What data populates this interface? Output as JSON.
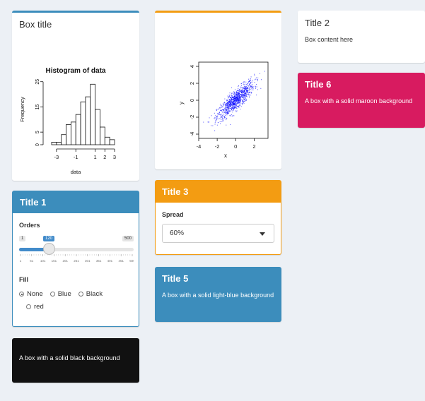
{
  "box_hist": {
    "title": "Box title",
    "chart_data": {
      "type": "bar",
      "title": "Histogram of data",
      "xlabel": "data",
      "ylabel": "Frequency",
      "x_ticks": [
        "-3",
        "-1",
        "1",
        "2",
        "3"
      ],
      "y_ticks": [
        "0",
        "5",
        "15",
        "25"
      ],
      "bins": [
        -3.5,
        -3,
        -2.5,
        -2,
        -1.5,
        -1,
        -0.5,
        0,
        0.5,
        1,
        1.5,
        2,
        2.5,
        3
      ],
      "values": [
        1,
        1,
        4,
        8,
        9,
        12,
        17,
        19,
        24,
        14,
        7,
        3,
        2
      ],
      "ylim": [
        0,
        28
      ]
    }
  },
  "box_scatter": {
    "chart_data": {
      "type": "scatter",
      "xlabel": "x",
      "ylabel": "y",
      "x_ticks": [
        "-4",
        "-2",
        "0",
        "2"
      ],
      "y_ticks": [
        "-4",
        "-2",
        "0",
        "2",
        "4"
      ],
      "xlim": [
        -4,
        3.5
      ],
      "ylim": [
        -4.5,
        4.5
      ],
      "point_color": "#0000ff",
      "correlation": 0.85,
      "n_points": 1000
    }
  },
  "box_title2": {
    "title": "Title 2",
    "content": "Box content here"
  },
  "box_title6": {
    "title": "Title 6",
    "content": "A box with a solid maroon background",
    "color": "#d81b60"
  },
  "box_title1": {
    "title": "Title 1",
    "color": "#3c8dbc",
    "slider": {
      "label": "Orders",
      "min": "1",
      "max": "500",
      "value": "120",
      "ticks": [
        "1",
        "51",
        "101",
        "151",
        "201",
        "251",
        "301",
        "351",
        "401",
        "451",
        "500"
      ]
    },
    "fill": {
      "label": "Fill",
      "options": [
        "None",
        "Blue",
        "Black",
        "red"
      ],
      "selected": "None"
    }
  },
  "box_title3": {
    "title": "Title 3",
    "color": "#f39c12",
    "select_label": "Spread",
    "select_value": "60%"
  },
  "box_title5": {
    "title": "Title 5",
    "content": "A box with a solid light-blue background",
    "color": "#3c8dbc"
  },
  "box_black": {
    "content": "A box with a solid black background",
    "color": "#111111"
  }
}
